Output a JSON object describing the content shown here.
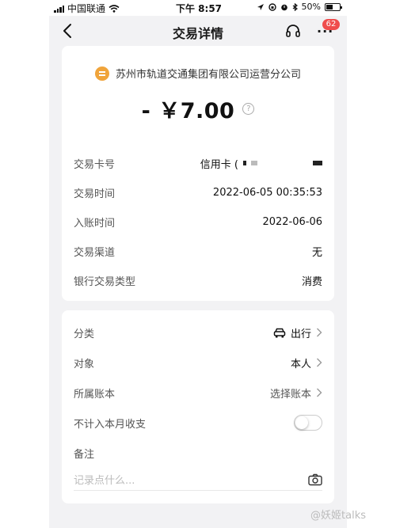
{
  "status_bar": {
    "carrier": "中国联通",
    "time": "下午 8:57",
    "battery_percent": "50%",
    "battery_level": 0.5
  },
  "nav": {
    "title": "交易详情",
    "more_label": "···",
    "badge_count": "62"
  },
  "merchant": {
    "name": "苏州市轨道交通集团有限公司运营分公司",
    "logo_color": "#f0a43b"
  },
  "amount": "- ￥7.00",
  "help_symbol": "?",
  "details": [
    {
      "label": "交易卡号",
      "value": "信用卡 ("
    },
    {
      "label": "交易时间",
      "value": "2022-06-05 00:35:53"
    },
    {
      "label": "入账时间",
      "value": "2022-06-06"
    },
    {
      "label": "交易渠道",
      "value": "无"
    },
    {
      "label": "银行交易类型",
      "value": "消费"
    }
  ],
  "meta": {
    "category": {
      "label": "分类",
      "value": "出行",
      "icon": "car-icon"
    },
    "target": {
      "label": "对象",
      "value": "本人"
    },
    "account": {
      "label": "所属账本",
      "value": "选择账本"
    },
    "exclude": {
      "label": "不计入本月收支",
      "enabled": false
    },
    "note": {
      "label": "备注",
      "placeholder": "记录点什么..."
    }
  },
  "watermark": "@妖姬talks",
  "colors": {
    "badge": "#ef4d4d",
    "background": "#f2f2f4"
  }
}
